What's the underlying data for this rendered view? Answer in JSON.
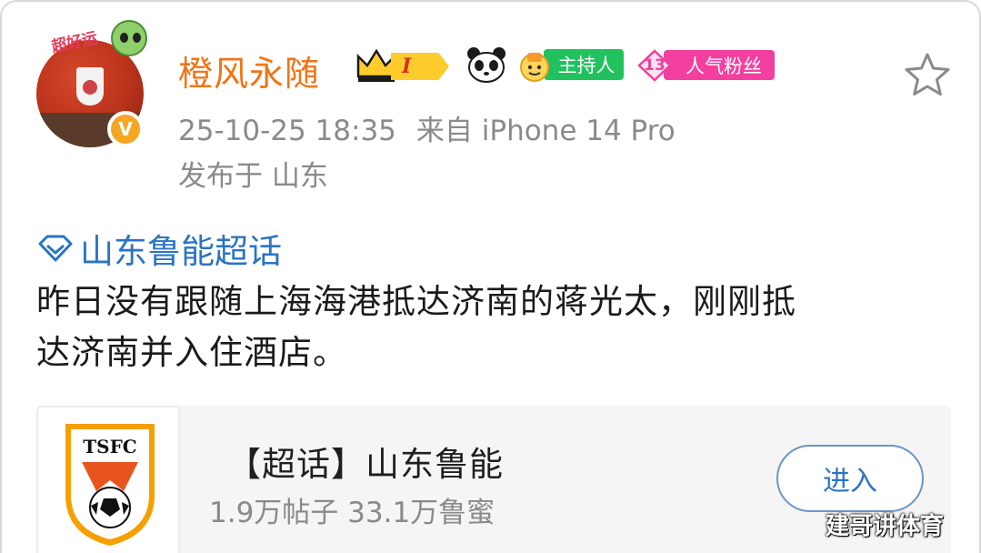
{
  "post": {
    "author": {
      "name": "橙风永随",
      "avatar_sticker_text": "超好运",
      "verified_badge": "V",
      "level_badge": "I",
      "host_badge": "主持人",
      "fan_badge_level": "13",
      "fan_badge_label": "人气粉丝"
    },
    "timestamp": "25-10-25 18:35",
    "source": "来自 iPhone 14 Pro",
    "location": "发布于 山东",
    "topic": "山东鲁能超话",
    "text_line1": "昨日没有跟随上海海港抵达济南的蒋光太，刚刚抵",
    "text_line2": "达济南并入住酒店。"
  },
  "card": {
    "logo_text": "TSFC",
    "title": "【超话】山东鲁能",
    "stats": "1.9万帖子 33.1万鲁蜜",
    "enter_label": "进入"
  },
  "watermark": "建哥讲体育",
  "icons": [
    "star-icon",
    "verified-icon",
    "crown-icon",
    "panda-icon",
    "host-icon",
    "diamond-topic-icon"
  ],
  "colors": {
    "username": "#f07416",
    "topic_link": "#2a74c4",
    "meta_text": "#8a8a8a",
    "host_badge": "#21c25e",
    "fan_badge": "#f23fa0",
    "verified": "#f5a623"
  }
}
